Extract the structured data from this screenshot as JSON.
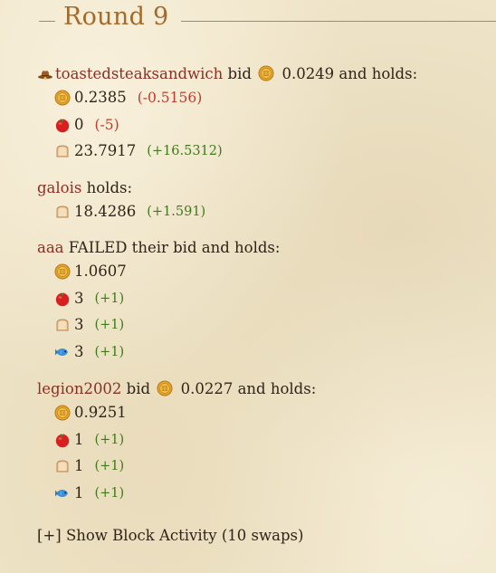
{
  "round": {
    "title": "Round 9"
  },
  "players": [
    {
      "name": "toastedsteaksandwich",
      "has_hat": true,
      "action_text": " bid ",
      "bid_amount": "0.0249",
      "tail_text": " and holds:",
      "holdings": [
        {
          "icon": "coin-icon",
          "amount": "0.2385",
          "delta": "(-0.5156)",
          "delta_sign": "neg"
        },
        {
          "icon": "tomato-icon",
          "amount": "0",
          "delta": "(-5)",
          "delta_sign": "neg"
        },
        {
          "icon": "bread-icon",
          "amount": "23.7917",
          "delta": "(+16.5312)",
          "delta_sign": "pos"
        }
      ]
    },
    {
      "name": "galois",
      "has_hat": false,
      "action_text": " holds:",
      "bid_amount": null,
      "tail_text": "",
      "holdings": [
        {
          "icon": "bread-icon",
          "amount": "18.4286",
          "delta": "(+1.591)",
          "delta_sign": "pos"
        }
      ]
    },
    {
      "name": "aaa",
      "has_hat": false,
      "action_text": " FAILED their bid and holds:",
      "bid_amount": null,
      "tail_text": "",
      "holdings": [
        {
          "icon": "coin-icon",
          "amount": "1.0607",
          "delta": "",
          "delta_sign": ""
        },
        {
          "icon": "tomato-icon",
          "amount": "3",
          "delta": "(+1)",
          "delta_sign": "pos"
        },
        {
          "icon": "bread-icon",
          "amount": "3",
          "delta": "(+1)",
          "delta_sign": "pos"
        },
        {
          "icon": "fish-icon",
          "amount": "3",
          "delta": "(+1)",
          "delta_sign": "pos"
        }
      ]
    },
    {
      "name": "legion2002",
      "has_hat": false,
      "action_text": " bid ",
      "bid_amount": "0.0227",
      "tail_text": " and holds:",
      "holdings": [
        {
          "icon": "coin-icon",
          "amount": "0.9251",
          "delta": "",
          "delta_sign": ""
        },
        {
          "icon": "tomato-icon",
          "amount": "1",
          "delta": "(+1)",
          "delta_sign": "pos"
        },
        {
          "icon": "bread-icon",
          "amount": "1",
          "delta": "(+1)",
          "delta_sign": "pos"
        },
        {
          "icon": "fish-icon",
          "amount": "1",
          "delta": "(+1)",
          "delta_sign": "pos"
        }
      ]
    }
  ],
  "footer": {
    "toggle_label": "[+] Show Block Activity (10 swaps)"
  },
  "colors": {
    "title": "#a36a2c",
    "player_name": "#8a2f23",
    "delta_negative": "#c0392b",
    "delta_positive": "#3f7a1a"
  }
}
